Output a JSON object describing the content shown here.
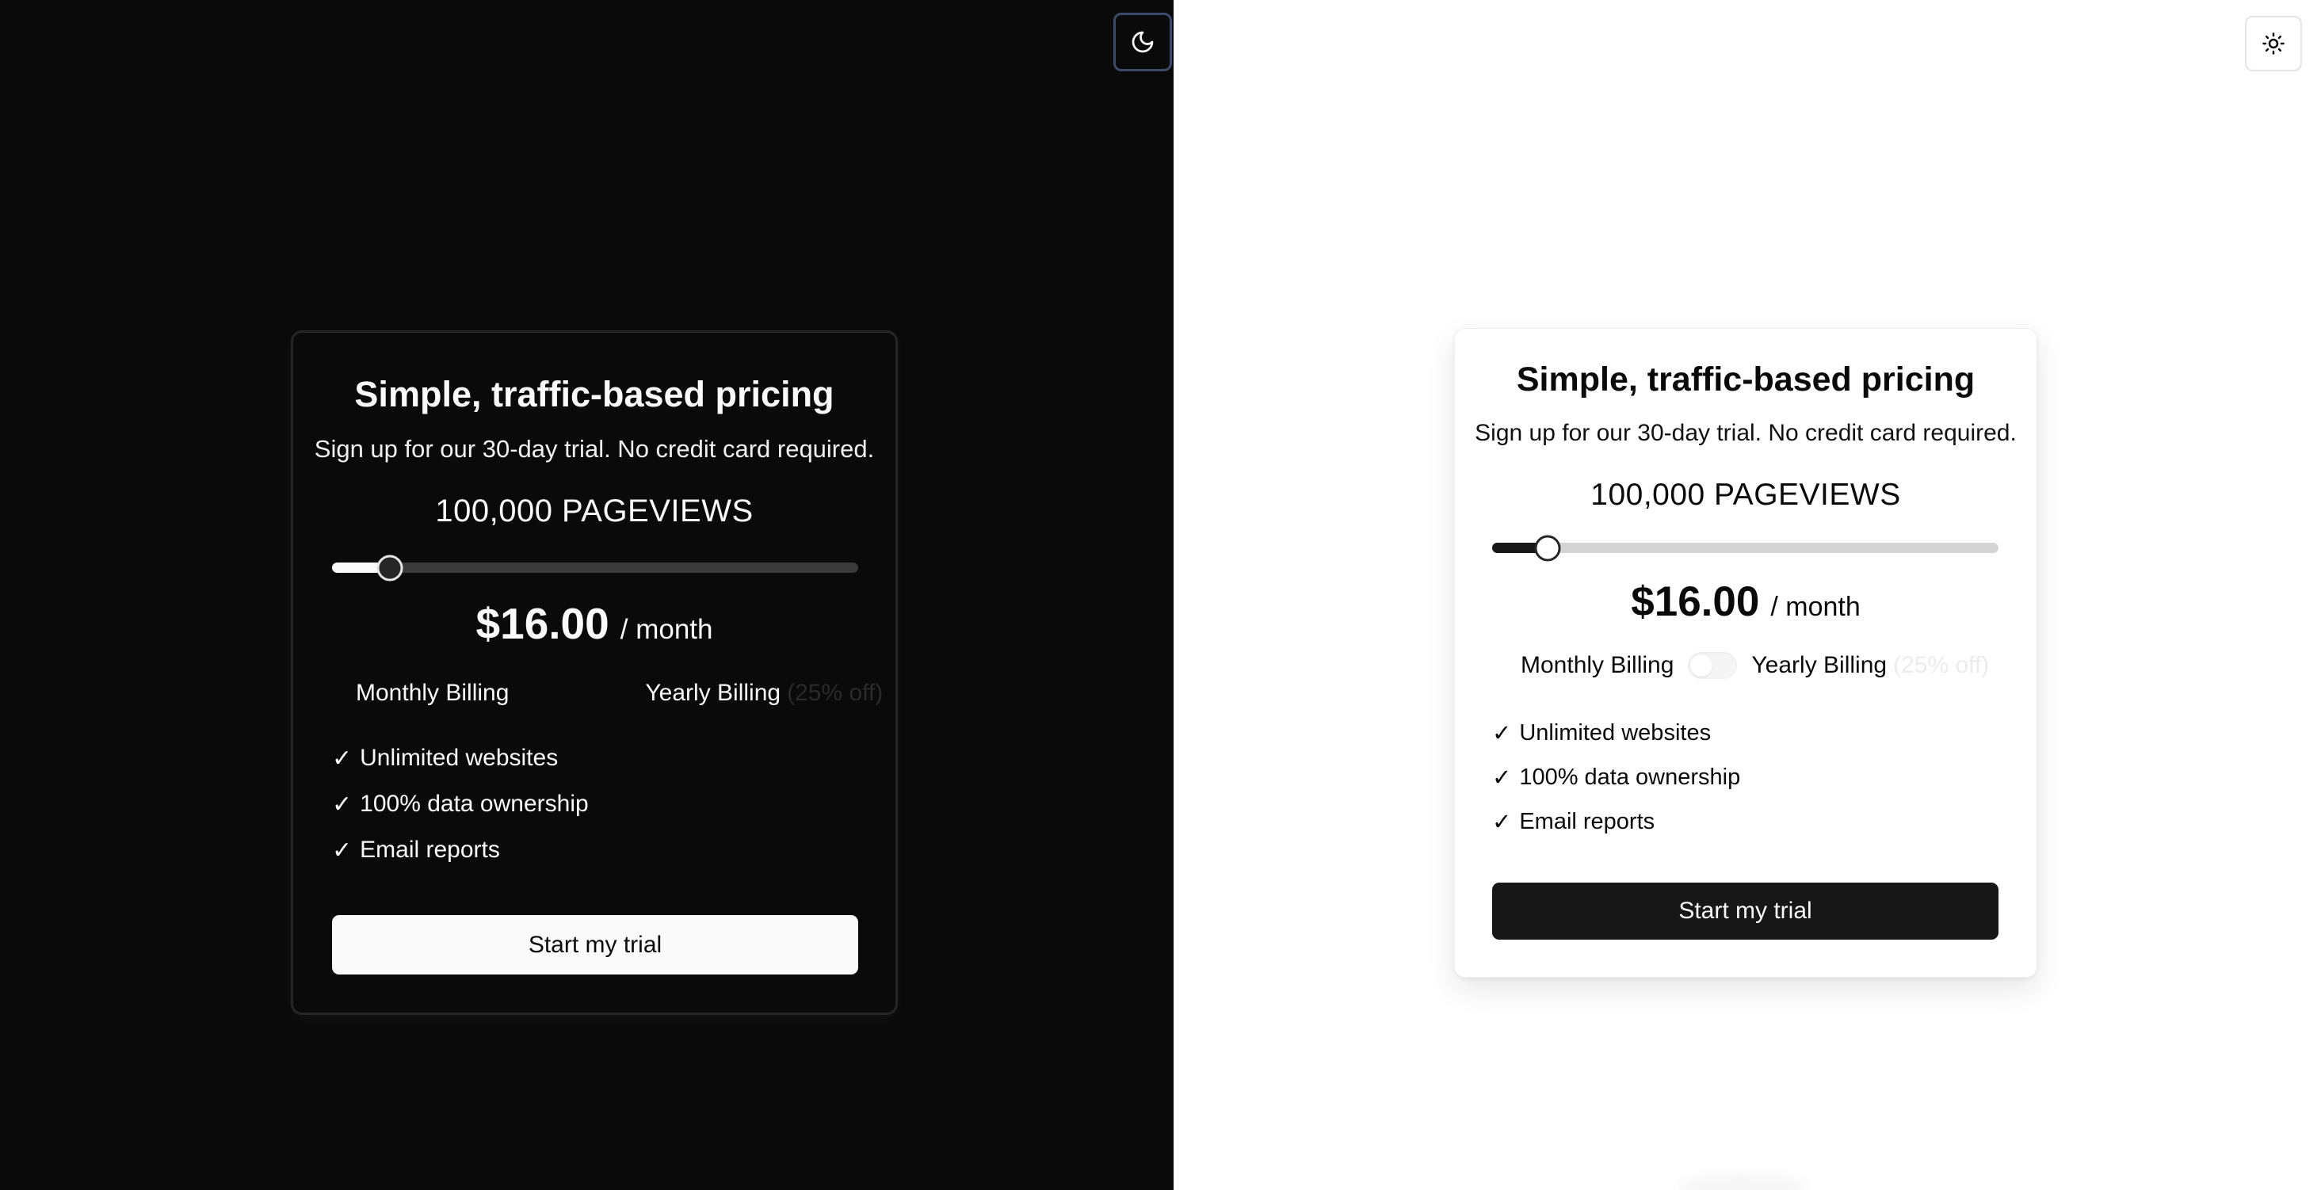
{
  "theme_toggle": {
    "dark_icon": "moon-icon",
    "light_icon": "sun-icon"
  },
  "pricing": {
    "title": "Simple, traffic-based pricing",
    "subtitle": "Sign up for our 30-day trial. No credit card required.",
    "pageviews": "100,000 PAGEVIEWS",
    "slider_value_fraction": 0.11,
    "price": "$16.00",
    "period": "/ month",
    "billing": {
      "monthly_label": "Monthly Billing",
      "yearly_label": "Yearly Billing",
      "discount": "(25% off)",
      "yearly_selected": false
    },
    "features": [
      {
        "check": "✓",
        "text": "Unlimited websites"
      },
      {
        "check": "✓",
        "text": "100% data ownership"
      },
      {
        "check": "✓",
        "text": "Email reports"
      }
    ],
    "cta_label": "Start my trial"
  },
  "colors": {
    "dark_background": "#0a0a0a",
    "dark_foreground": "#fafafa",
    "light_background": "#ffffff",
    "light_foreground": "#0a0a0a",
    "dark_toggle_button_border": "#3b4a6b"
  }
}
